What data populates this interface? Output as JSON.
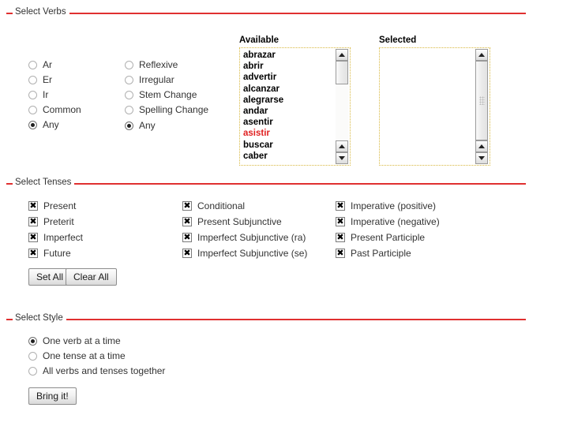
{
  "sections": {
    "verbs": {
      "legend": "Select Verbs"
    },
    "tenses": {
      "legend": "Select Tenses"
    },
    "style": {
      "legend": "Select Style"
    }
  },
  "verb_type_radios": [
    {
      "label": "Ar",
      "checked": false
    },
    {
      "label": "Er",
      "checked": false
    },
    {
      "label": "Ir",
      "checked": false
    },
    {
      "label": "Common",
      "checked": false
    },
    {
      "label": "Any",
      "checked": true
    }
  ],
  "verb_form_radios": [
    {
      "label": "Reflexive",
      "checked": false
    },
    {
      "label": "Irregular",
      "checked": false
    },
    {
      "label": "Stem Change",
      "checked": false
    },
    {
      "label": "Spelling Change",
      "checked": false
    },
    {
      "label": "Any",
      "checked": true
    }
  ],
  "available_list": {
    "header": "Available",
    "items": [
      {
        "text": "abrazar",
        "highlighted": false
      },
      {
        "text": "abrir",
        "highlighted": false
      },
      {
        "text": "advertir",
        "highlighted": false
      },
      {
        "text": "alcanzar",
        "highlighted": false
      },
      {
        "text": "alegrarse",
        "highlighted": false
      },
      {
        "text": "andar",
        "highlighted": false
      },
      {
        "text": "asentir",
        "highlighted": false
      },
      {
        "text": "asistir",
        "highlighted": true
      },
      {
        "text": "buscar",
        "highlighted": false
      },
      {
        "text": "caber",
        "highlighted": false
      }
    ]
  },
  "selected_list": {
    "header": "Selected",
    "items": []
  },
  "tense_checkboxes_col1": [
    {
      "label": "Present",
      "checked": true
    },
    {
      "label": "Preterit",
      "checked": true
    },
    {
      "label": "Imperfect",
      "checked": true
    },
    {
      "label": "Future",
      "checked": true
    }
  ],
  "tense_checkboxes_col2": [
    {
      "label": "Conditional",
      "checked": true
    },
    {
      "label": "Present Subjunctive",
      "checked": true
    },
    {
      "label": "Imperfect Subjunctive (ra)",
      "checked": true
    },
    {
      "label": "Imperfect Subjunctive (se)",
      "checked": true
    }
  ],
  "tense_checkboxes_col3": [
    {
      "label": "Imperative (positive)",
      "checked": true
    },
    {
      "label": "Imperative (negative)",
      "checked": true
    },
    {
      "label": "Present Participle",
      "checked": true
    },
    {
      "label": "Past Participle",
      "checked": true
    }
  ],
  "tense_buttons": {
    "set_all": "Set All",
    "clear_all": "Clear All"
  },
  "style_radios": [
    {
      "label": "One verb at a time",
      "checked": true
    },
    {
      "label": "One tense at a time",
      "checked": false
    },
    {
      "label": "All verbs and tenses together",
      "checked": false
    }
  ],
  "submit_button": {
    "label": "Bring it!"
  },
  "icons": {
    "checkbox_mark": "✖",
    "scroll_up": "scroll-up-arrow-icon",
    "scroll_down": "scroll-down-arrow-icon"
  },
  "colors": {
    "rule": "#e03030",
    "highlight": "#e02020",
    "list_border": "#d8b840"
  }
}
